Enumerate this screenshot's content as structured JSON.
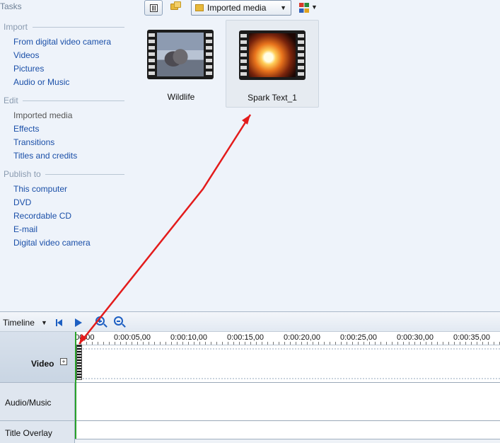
{
  "tasks_panel": {
    "title": "Tasks",
    "sections": [
      {
        "heading": "Import",
        "items": [
          "From digital video camera",
          "Videos",
          "Pictures",
          "Audio or Music"
        ]
      },
      {
        "heading": "Edit",
        "items": [
          "Imported media",
          "Effects",
          "Transitions",
          "Titles and credits"
        ]
      },
      {
        "heading": "Publish to",
        "items": [
          "This computer",
          "DVD",
          "Recordable CD",
          "E-mail",
          "Digital video camera"
        ]
      }
    ]
  },
  "toolbar": {
    "collection_selected": "Imported media",
    "icons": [
      "details-view-icon",
      "collection-folder-icon",
      "arrange-icon"
    ]
  },
  "media": {
    "clips": [
      {
        "label": "Wildlife",
        "selected": false
      },
      {
        "label": "Spark Text_1",
        "selected": true
      }
    ]
  },
  "timeline": {
    "mode_label": "Timeline",
    "ruler_ticks": [
      "00,00",
      "0:00:05,00",
      "0:00:10,00",
      "0:00:15,00",
      "0:00:20,00",
      "0:00:25,00",
      "0:00:30,00",
      "0:00:35,00"
    ],
    "tracks": [
      "Video",
      "Audio/Music",
      "Title Overlay"
    ],
    "expand_symbol": "+"
  },
  "colors": {
    "annotation_arrow": "#e31b1b",
    "link": "#1a4fa8",
    "playhead": "#2aa32a"
  }
}
